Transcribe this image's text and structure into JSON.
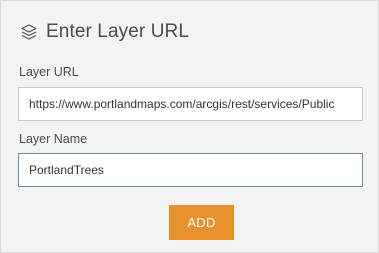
{
  "dialog": {
    "title": "Enter Layer URL",
    "icon": "layers-icon",
    "url_field": {
      "label": "Layer URL",
      "value": "https://www.portlandmaps.com/arcgis/rest/services/Public"
    },
    "name_field": {
      "label": "Layer Name",
      "value": "PortlandTrees"
    },
    "add_button_label": "ADD"
  },
  "colors": {
    "panel_background": "#f3f3f3",
    "accent_button": "#e6902e",
    "focused_input_border": "#6e8fb2",
    "text": "#4c4c4c"
  }
}
